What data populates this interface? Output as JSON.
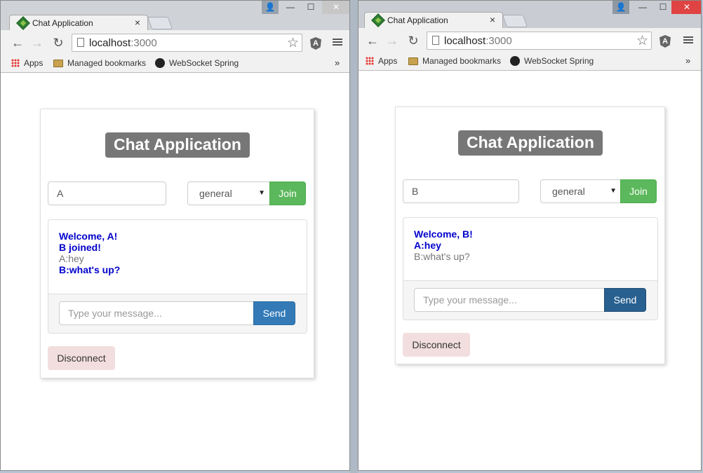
{
  "browser": {
    "tab_title": "Chat Application",
    "tab_close": "×",
    "url_host": "localhost",
    "url_port": ":3000",
    "bookmarks": {
      "apps": "Apps",
      "managed": "Managed bookmarks",
      "websocket": "WebSocket Spring",
      "more": "»"
    },
    "window_controls": {
      "user": "👤",
      "minimize": "—",
      "maximize": "☐",
      "close": "✕"
    },
    "nav": {
      "back": "←",
      "forward": "→",
      "reload": "↻",
      "star": "☆",
      "extension": "A"
    }
  },
  "windows": [
    {
      "app_title": "Chat Application",
      "username": "A",
      "room": "general",
      "join_label": "Join",
      "messages": [
        {
          "text": "Welcome, A!",
          "style": "bold"
        },
        {
          "text": "B joined!",
          "style": "bold"
        },
        {
          "text": "A:hey",
          "style": "plain"
        },
        {
          "text": "B:what's up?",
          "style": "bold"
        }
      ],
      "message_placeholder": "Type your message...",
      "send_label": "Send",
      "disconnect_label": "Disconnect"
    },
    {
      "app_title": "Chat Application",
      "username": "B",
      "room": "general",
      "join_label": "Join",
      "messages": [
        {
          "text": "Welcome, B!",
          "style": "bold"
        },
        {
          "text": "A:hey",
          "style": "bold"
        },
        {
          "text": "B:what's up?",
          "style": "plain"
        }
      ],
      "message_placeholder": "Type your message...",
      "send_label": "Send",
      "disconnect_label": "Disconnect"
    }
  ],
  "colors": {
    "join": "#5cb85c",
    "send": "#337ab7",
    "title_badge": "#777777",
    "disconnect": "#f2dede",
    "message_bold": "#0000cc"
  }
}
